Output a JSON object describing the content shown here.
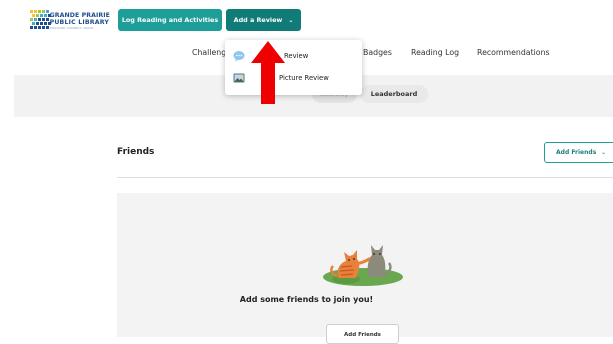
{
  "header": {
    "logo": {
      "line1": "GRANDE PRAIRIE",
      "line2": "PUBLIC LIBRARY",
      "line3": "DISCOVER. CONNECT. GROW."
    },
    "log_button_label": "Log Reading and Activities",
    "review_button_label": "Add a Review",
    "review_button_chevron": "⌄"
  },
  "nav": {
    "items": [
      {
        "label": "Challeng"
      },
      {
        "label": "Badges"
      },
      {
        "label": "Reading Log"
      },
      {
        "label": "Recommendations"
      }
    ]
  },
  "dropdown": {
    "items": [
      {
        "label": "Review",
        "icon": "speech-bubble-icon"
      },
      {
        "label": "Picture Review",
        "icon": "picture-icon"
      }
    ]
  },
  "tabs": {
    "hidden_label": "Activity",
    "leaderboard_label": "Leaderboard"
  },
  "friends": {
    "title": "Friends",
    "add_friends_label": "Add Friends",
    "add_friends_chevron": "⌄",
    "empty_message": "Add some friends to join you!",
    "bottom_button_label": "Add Friends"
  },
  "colors": {
    "teal": "#1e9e98",
    "teal_dark": "#117b78",
    "annotation_red": "#ee0000"
  }
}
